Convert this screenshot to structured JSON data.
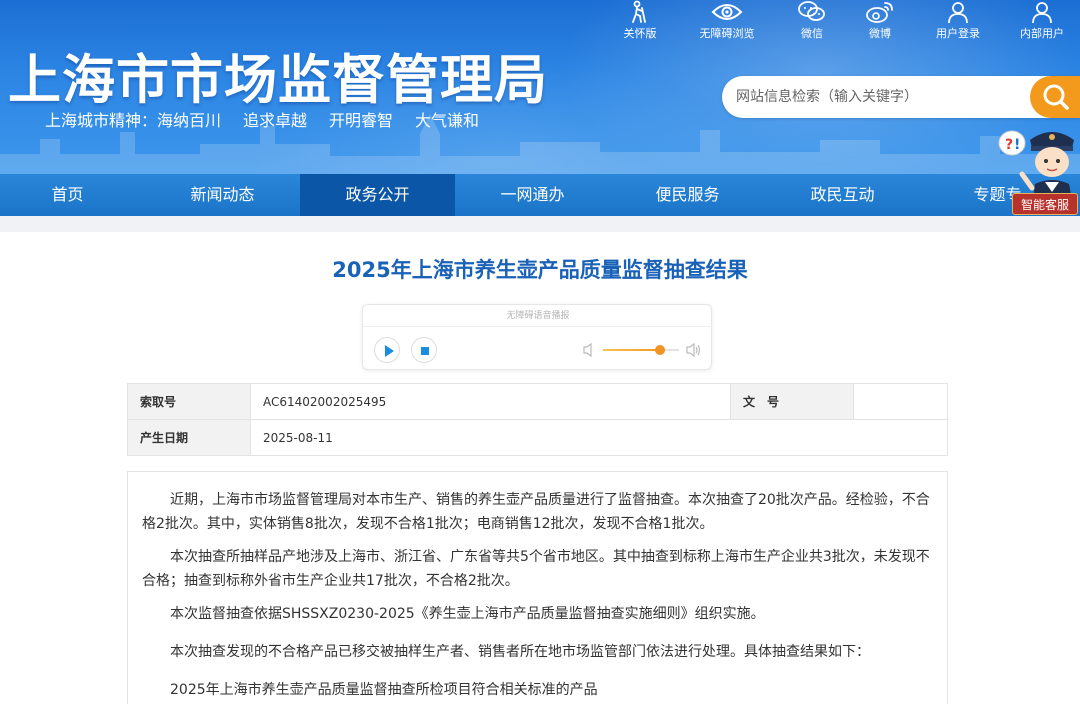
{
  "header": {
    "site_title": "上海市市场监督管理局",
    "motto_prefix": "上海城市精神：海纳百川",
    "motto_items": [
      "追求卓越",
      "开明睿智",
      "大气谦和"
    ],
    "search_placeholder": "网站信息检索（输入关键字）",
    "toolbar": [
      {
        "label": "关怀版",
        "icon": "elder-care-icon"
      },
      {
        "label": "无障碍浏览",
        "icon": "eye-icon"
      },
      {
        "label": "微信",
        "icon": "wechat-icon"
      },
      {
        "label": "微博",
        "icon": "weibo-icon"
      },
      {
        "label": "用户登录",
        "icon": "user-icon"
      },
      {
        "label": "内部用户",
        "icon": "user-icon"
      }
    ],
    "customer_service_label": "智能客服"
  },
  "nav": {
    "items": [
      "首页",
      "新闻动态",
      "政务公开",
      "一网通办",
      "便民服务",
      "政民互动",
      "专题专"
    ],
    "active_index": 2
  },
  "article": {
    "title": "2025年上海市养生壶产品质量监督抽查结果",
    "player_label": "无障碍语音播报",
    "volume_level": 0.75,
    "meta": {
      "index_label": "索取号",
      "index_value": "AC61402002025495",
      "doc_no_label": "文　号",
      "doc_no_value": "",
      "date_label": "产生日期",
      "date_value": "2025-08-11"
    },
    "paragraphs": [
      "近期，上海市市场监督管理局对本市生产、销售的养生壶产品质量进行了监督抽查。本次抽查了20批次产品。经检验，不合格2批次。其中，实体销售8批次，发现不合格1批次；电商销售12批次，发现不合格1批次。",
      "本次抽查所抽样品产地涉及上海市、浙江省、广东省等共5个省市地区。其中抽查到标称上海市生产企业共3批次，未发现不合格；抽查到标称外省市生产企业共17批次，不合格2批次。",
      "本次监督抽查依据SHSSXZ0230-2025《养生壶上海市产品质量监督抽查实施细则》组织实施。",
      "本次抽查发现的不合格产品已移交被抽样生产者、销售者所在地市场监管部门依法进行处理。具体抽查结果如下：",
      "2025年上海市养生壶产品质量监督抽查所检项目符合相关标准的产品"
    ]
  },
  "colors": {
    "header_blue": "#2d86e4",
    "nav_blue": "#1b74c8",
    "nav_active": "#0c56a8",
    "title_blue": "#1a62b8",
    "accent_orange": "#f39a1c",
    "service_red": "#b8322c"
  }
}
